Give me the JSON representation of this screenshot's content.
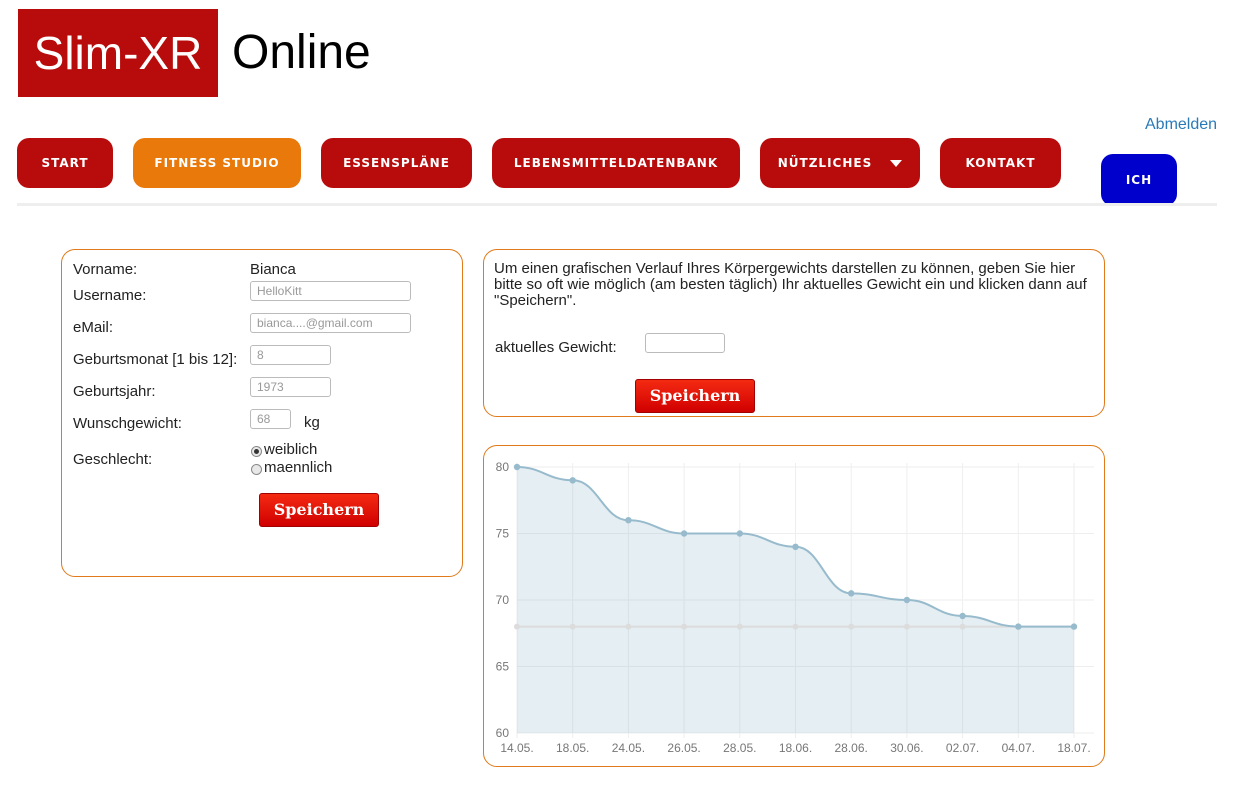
{
  "header": {
    "logo_box_text": "Slim-XR",
    "logo_text": "Online",
    "logout": "Abmelden"
  },
  "nav": {
    "items": [
      {
        "label": "START"
      },
      {
        "label": "FITNESS STUDIO",
        "active": true
      },
      {
        "label": "ESSENSPLÄNE"
      },
      {
        "label": "LEBENSMITTELDATENBANK"
      },
      {
        "label": "NÜTZLICHES",
        "has_dropdown": true
      },
      {
        "label": "KONTAKT"
      },
      {
        "label": "ICH"
      }
    ]
  },
  "profile": {
    "firstname_label": "Vorname:",
    "firstname_value": "Bianca",
    "username_label": "Username:",
    "username_value": "HelloKitt",
    "email_label": "eMail:",
    "email_value": "bianca....@gmail.com",
    "birthmonth_label": "Geburtsmonat [1 bis 12]:",
    "birthmonth_value": "8",
    "birthyear_label": "Geburtsjahr:",
    "birthyear_value": "1973",
    "targetweight_label": "Wunschgewicht:",
    "targetweight_value": "68",
    "targetweight_unit": "kg",
    "gender_label": "Geschlecht:",
    "gender_female": "weiblich",
    "gender_male": "maennlich",
    "gender_selected": "weiblich",
    "save_label": "Speichern"
  },
  "weight_entry": {
    "instructions": "Um einen grafischen Verlauf Ihres Körpergewichts darstellen zu können, geben Sie hier bitte so oft wie möglich (am besten täglich) Ihr aktuelles Gewicht ein und klicken dann auf \"Speichern\".",
    "current_weight_label": "aktuelles Gewicht:",
    "current_weight_value": "",
    "save_label": "Speichern"
  },
  "chart_data": {
    "type": "area",
    "categories": [
      "14.05.",
      "18.05.",
      "24.05.",
      "26.05.",
      "28.05.",
      "18.06.",
      "28.06.",
      "30.06.",
      "02.07.",
      "04.07.",
      "18.07."
    ],
    "series": [
      {
        "values": [
          80,
          79,
          76,
          75,
          75,
          74,
          70.5,
          70,
          68.8,
          68,
          68
        ],
        "color": "#97bbcd"
      },
      {
        "values": [
          68,
          68,
          68,
          68,
          68,
          68,
          68,
          68,
          68,
          68,
          68
        ],
        "color": "#dcdcdc"
      }
    ],
    "yticks": [
      60,
      65,
      70,
      75,
      80
    ],
    "ylim": [
      60,
      80
    ],
    "grid": true
  }
}
